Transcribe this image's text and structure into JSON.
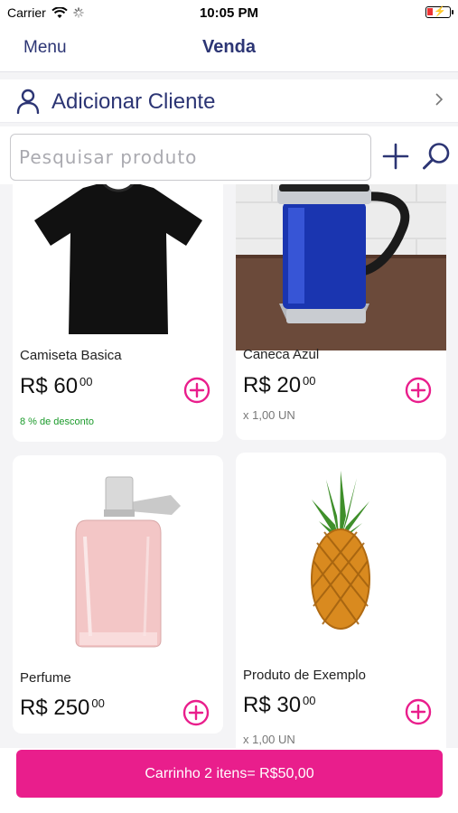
{
  "status_bar": {
    "carrier": "Carrier",
    "time": "10:05 PM"
  },
  "nav": {
    "menu_label": "Menu",
    "title": "Venda"
  },
  "client": {
    "label": "Adicionar Cliente"
  },
  "search": {
    "placeholder": "Pesquisar produto"
  },
  "products": [
    {
      "name": "Camiseta Basica",
      "price_int": "R$ 60",
      "price_cents": "00",
      "note": "8 % de desconto",
      "note_color": "#1a9a2a"
    },
    {
      "name": "Caneca Azul",
      "price_int": "R$ 20",
      "price_cents": "00",
      "note": "x 1,00 UN",
      "note_color": "#777777"
    },
    {
      "name": "Perfume",
      "price_int": "R$ 250",
      "price_cents": "00",
      "note": "",
      "note_color": "#777777"
    },
    {
      "name": "Produto de Exemplo",
      "price_int": "R$ 30",
      "price_cents": "00",
      "note": "x 1,00 UN",
      "note_color": "#777777"
    }
  ],
  "cart": {
    "label": "Carrinho 2 itens= R$50,00"
  },
  "colors": {
    "accent": "#e91e8c",
    "primary": "#2c3574"
  }
}
